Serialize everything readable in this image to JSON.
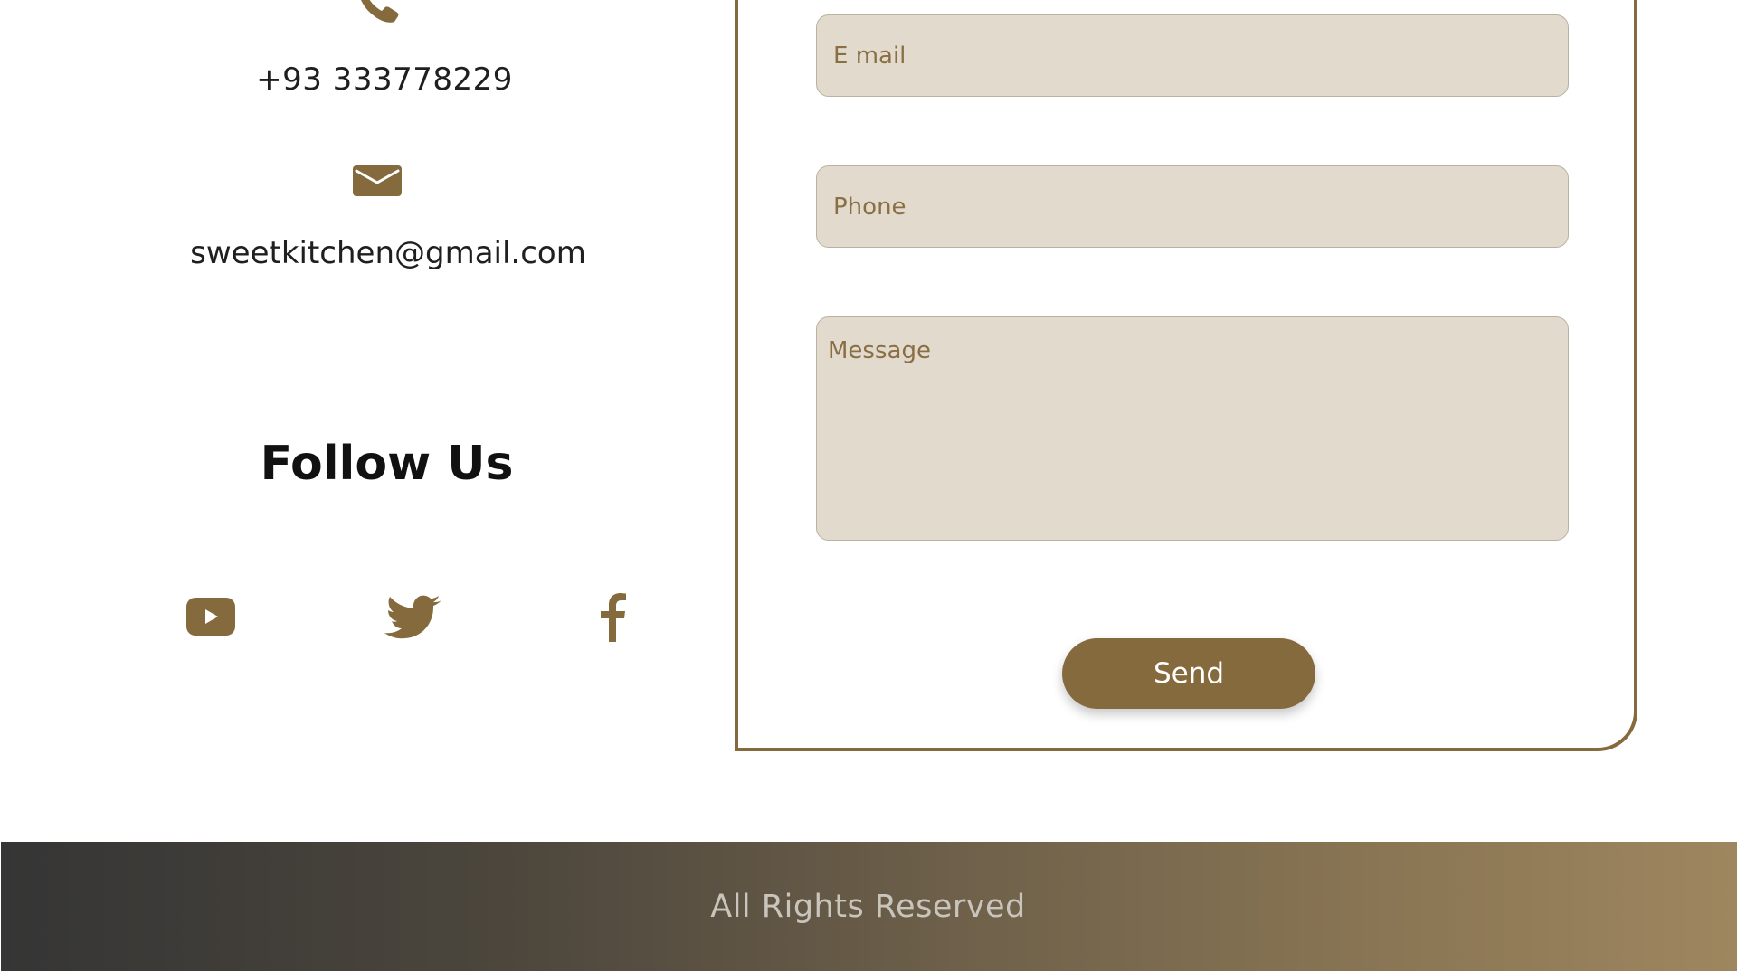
{
  "contact": {
    "phone": "+93 333778229",
    "email": "sweetkitchen@gmail.com",
    "phone_icon": "phone-icon",
    "mail_icon": "mail-icon"
  },
  "follow": {
    "title": "Follow Us",
    "socials": [
      {
        "name": "youtube-icon"
      },
      {
        "name": "twitter-icon"
      },
      {
        "name": "facebook-icon"
      }
    ]
  },
  "form": {
    "email_placeholder": "E mail",
    "phone_placeholder": "Phone",
    "message_placeholder": "Message",
    "send_label": "Send"
  },
  "footer": {
    "text": "All Rights Reserved"
  },
  "colors": {
    "accent": "#856a3d",
    "field_bg": "#e2dbcd",
    "footer_start": "#353535",
    "footer_end": "#9e865f"
  }
}
